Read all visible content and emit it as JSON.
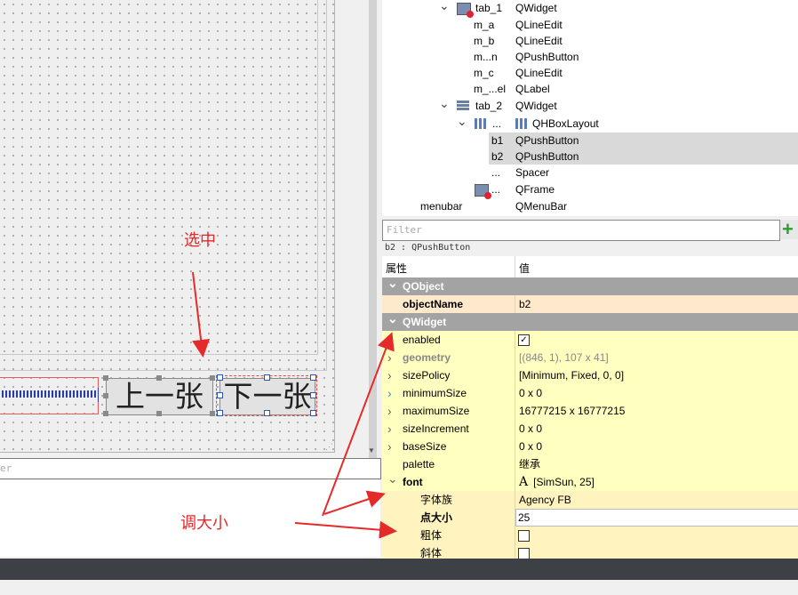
{
  "tree": {
    "rows": [
      {
        "name": "tab_1",
        "cls": "QWidget",
        "icon": "tab-widget-icon",
        "expand": "down",
        "selected": false
      },
      {
        "name": "m_a",
        "cls": "QLineEdit",
        "selected": false
      },
      {
        "name": "m_b",
        "cls": "QLineEdit",
        "selected": false
      },
      {
        "name": "m...n",
        "cls": "QPushButton",
        "selected": false
      },
      {
        "name": "m_c",
        "cls": "QLineEdit",
        "selected": false
      },
      {
        "name": "m_...el",
        "cls": "QLabel",
        "selected": false
      },
      {
        "name": "tab_2",
        "cls": "QWidget",
        "icon": "widget-icon",
        "expand": "down",
        "selected": false
      },
      {
        "name": "...",
        "cls": "QHBoxLayout",
        "icon": "hbox-layout-icon",
        "expand": "down",
        "selected": false
      },
      {
        "name": "b1",
        "cls": "QPushButton",
        "selected": true
      },
      {
        "name": "b2",
        "cls": "QPushButton",
        "selected": true
      },
      {
        "name": "...",
        "cls": "Spacer",
        "selected": false
      },
      {
        "name": "...",
        "cls": "QFrame",
        "icon": "frame-icon",
        "selected": false
      },
      {
        "name": "menubar",
        "cls": "QMenuBar",
        "selected": false
      }
    ]
  },
  "form": {
    "btn_prev": "上一张",
    "btn_next": "下一张"
  },
  "annotations": {
    "selected_label": "选中",
    "resize_label": "调大小",
    "color": "#e52a2a"
  },
  "left_filter": {
    "placeholder": "er"
  },
  "props": {
    "filter_placeholder": "Filter",
    "object_info": "b2 : QPushButton",
    "col_property": "属性",
    "col_value": "值",
    "rows": [
      {
        "type": "group",
        "name": "QObject"
      },
      {
        "type": "prop",
        "name": "objectName",
        "value": "b2",
        "bold": true,
        "bg": "ora"
      },
      {
        "type": "group",
        "name": "QWidget"
      },
      {
        "type": "prop",
        "name": "enabled",
        "check": true,
        "bg": "yel"
      },
      {
        "type": "prop",
        "name": "geometry",
        "value": "[(846, 1), 107 x 41]",
        "bold": true,
        "dim": true,
        "arrow": "right",
        "bg": "yel"
      },
      {
        "type": "prop",
        "name": "sizePolicy",
        "value": "[Minimum, Fixed, 0, 0]",
        "arrow": "right",
        "bg": "yel"
      },
      {
        "type": "prop",
        "name": "minimumSize",
        "value": "0 x 0",
        "arrow": "right-blue",
        "bg": "yel"
      },
      {
        "type": "prop",
        "name": "maximumSize",
        "value": "16777215 x 16777215",
        "arrow": "right",
        "bg": "yel"
      },
      {
        "type": "prop",
        "name": "sizeIncrement",
        "value": "0 x 0",
        "arrow": "right",
        "bg": "yel"
      },
      {
        "type": "prop",
        "name": "baseSize",
        "value": "0 x 0",
        "arrow": "right",
        "bg": "yel"
      },
      {
        "type": "prop",
        "name": "palette",
        "value": "继承",
        "bg": "yel"
      },
      {
        "type": "prop",
        "name": "font",
        "value": "[SimSun, 25]",
        "bold": true,
        "arrow": "down",
        "fontIcon": true,
        "bg": "yel"
      },
      {
        "type": "sub",
        "name": "字体族",
        "value": "Agency FB",
        "bg": "yel2"
      },
      {
        "type": "sub",
        "name": "点大小",
        "value": "25",
        "bold": true,
        "edit": true,
        "bg": "yel2"
      },
      {
        "type": "sub",
        "name": "粗体",
        "check": false,
        "bg": "yel2"
      },
      {
        "type": "sub",
        "name": "斜体",
        "check": false,
        "bg": "yel2"
      }
    ]
  }
}
